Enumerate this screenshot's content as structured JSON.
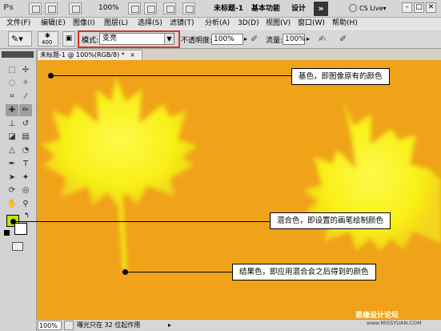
{
  "appbar": {
    "logo": "Ps",
    "zoom": "100%",
    "doc_title": "未标题-1",
    "workspace": "基本功能",
    "design": "设计",
    "more": "»",
    "cs_live": "CS Live▾",
    "win_min": "–",
    "win_max": "□",
    "win_close": "✕"
  },
  "menubar": {
    "items": [
      "文件(F)",
      "编辑(E)",
      "图像(I)",
      "图层(L)",
      "选择(S)",
      "滤镜(T)",
      "分析(A)",
      "3D(D)",
      "视图(V)",
      "窗口(W)",
      "帮助(H)"
    ]
  },
  "options": {
    "brush_size": "400",
    "mode_label": "模式:",
    "mode_value": "变亮",
    "opacity_label": "不透明度:",
    "opacity_value": "100%",
    "flow_label": "流量:",
    "flow_value": "100%"
  },
  "document": {
    "tab_label": "未标题-1 @ 100%(RGB/8) *",
    "callouts": [
      {
        "text": "基色，即图像原有的颜色"
      },
      {
        "text": "混合色，即设置的画笔绘制颜色"
      },
      {
        "text": "结果色，即应用混合会之后得到的颜色"
      }
    ]
  },
  "statusbar": {
    "zoom": "100%",
    "message": "曝光只在 32 位起作用"
  },
  "watermark": {
    "line1": "思缘设计论坛",
    "line2": "www.MISSYUAN.COM"
  },
  "colors": {
    "canvas_bg": "#f0a319",
    "leaf": "#f8f018",
    "foreground": "#b6e90a",
    "background": "#ffffff",
    "mode_highlight": "#e0302b"
  }
}
